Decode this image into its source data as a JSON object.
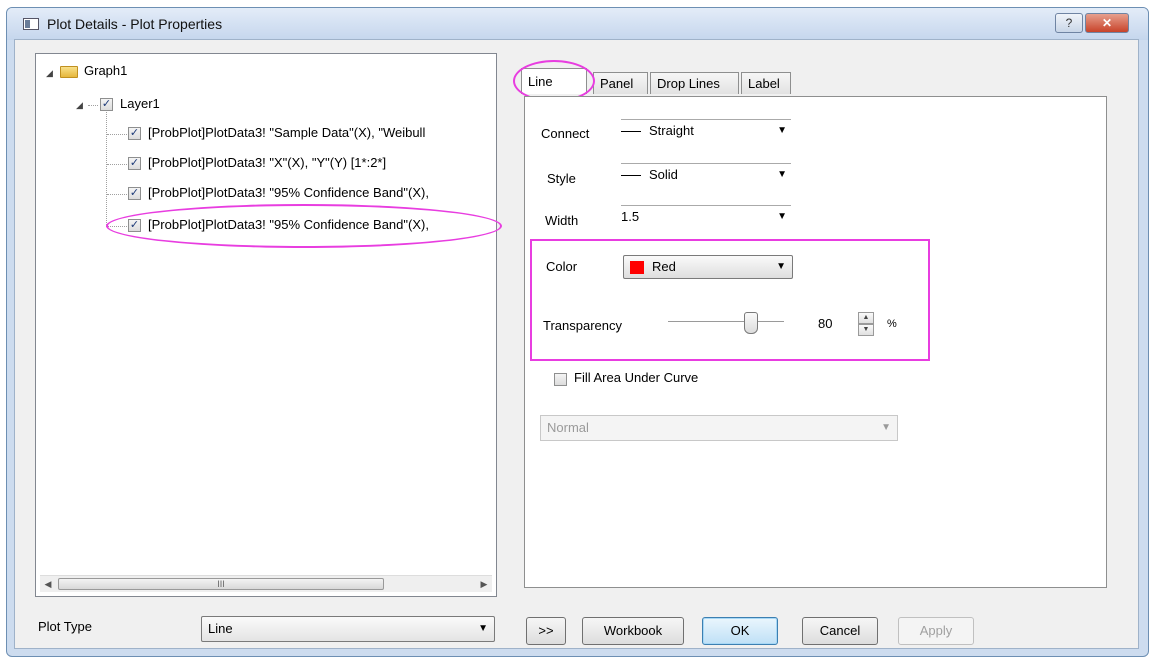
{
  "window": {
    "title": "Plot Details - Plot Properties",
    "help_label": "?",
    "close_label": "✕"
  },
  "tree": {
    "graph_label": "Graph1",
    "layer_label": "Layer1",
    "items": [
      {
        "label": "[ProbPlot]PlotData3! \"Sample Data\"(X), \"Weibull",
        "checked": true
      },
      {
        "label": "[ProbPlot]PlotData3! \"X\"(X), \"Y\"(Y) [1*:2*]",
        "checked": true
      },
      {
        "label": "[ProbPlot]PlotData3! \"95% Confidence Band\"(X),",
        "checked": true
      },
      {
        "label": "[ProbPlot]PlotData3! \"95% Confidence Band\"(X),",
        "checked": true,
        "selected": true
      }
    ],
    "scroll_thumb_label": "III"
  },
  "tabs": [
    {
      "label": "Line",
      "active": true
    },
    {
      "label": "Panel"
    },
    {
      "label": "Drop Lines"
    },
    {
      "label": "Label"
    }
  ],
  "line": {
    "connect_label": "Connect",
    "connect_value": "Straight",
    "style_label": "Style",
    "style_value": "Solid",
    "width_label": "Width",
    "width_value": "1.5",
    "color_label": "Color",
    "color_value": "Red",
    "color_swatch": "#ff0000",
    "transparency_label": "Transparency",
    "transparency_value": "80",
    "transparency_unit": "%",
    "fill_label": "Fill Area Under Curve",
    "fill_checked": false,
    "fill_mode": "Normal"
  },
  "bottom": {
    "plot_type_label": "Plot Type",
    "plot_type_value": "Line",
    "expand_label": ">>",
    "workbook_label": "Workbook",
    "ok_label": "OK",
    "cancel_label": "Cancel",
    "apply_label": "Apply"
  },
  "colors": {
    "highlight": "#e83de0",
    "title_bar": "#cddcef"
  }
}
